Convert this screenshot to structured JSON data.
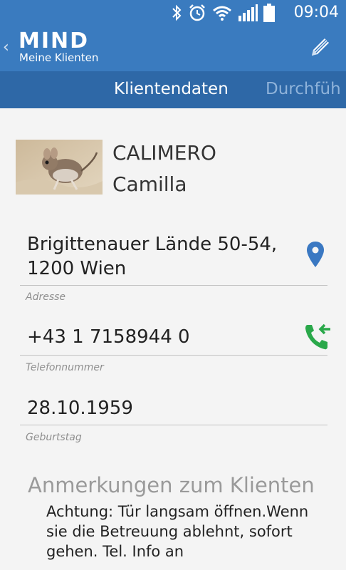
{
  "status": {
    "time": "09:04"
  },
  "header": {
    "logo": "MIND",
    "subtitle": "Meine Klienten"
  },
  "tabs": [
    {
      "label": "Klientendaten"
    },
    {
      "label": "Durchfüh"
    }
  ],
  "client": {
    "last_name": "CALIMERO",
    "first_name": "Camilla",
    "address_line1": "Brigittenauer Lände 50-54,",
    "address_line2": "1200 Wien",
    "address_label": "Adresse",
    "phone": "+43 1 7158944 0",
    "phone_label": "Telefonnummer",
    "birthday": "28.10.1959",
    "birthday_label": "Geburtstag"
  },
  "notes": {
    "title": "Anmerkungen zum Klienten",
    "text": "Achtung: Tür langsam öffnen.Wenn sie die Betreuung ablehnt, sofort gehen. Tel. Info an"
  },
  "colors": {
    "primary": "#3a7bbf",
    "tabbar": "#2e68a7",
    "pin": "#3a78c2",
    "phone_icon": "#2aa84a"
  }
}
